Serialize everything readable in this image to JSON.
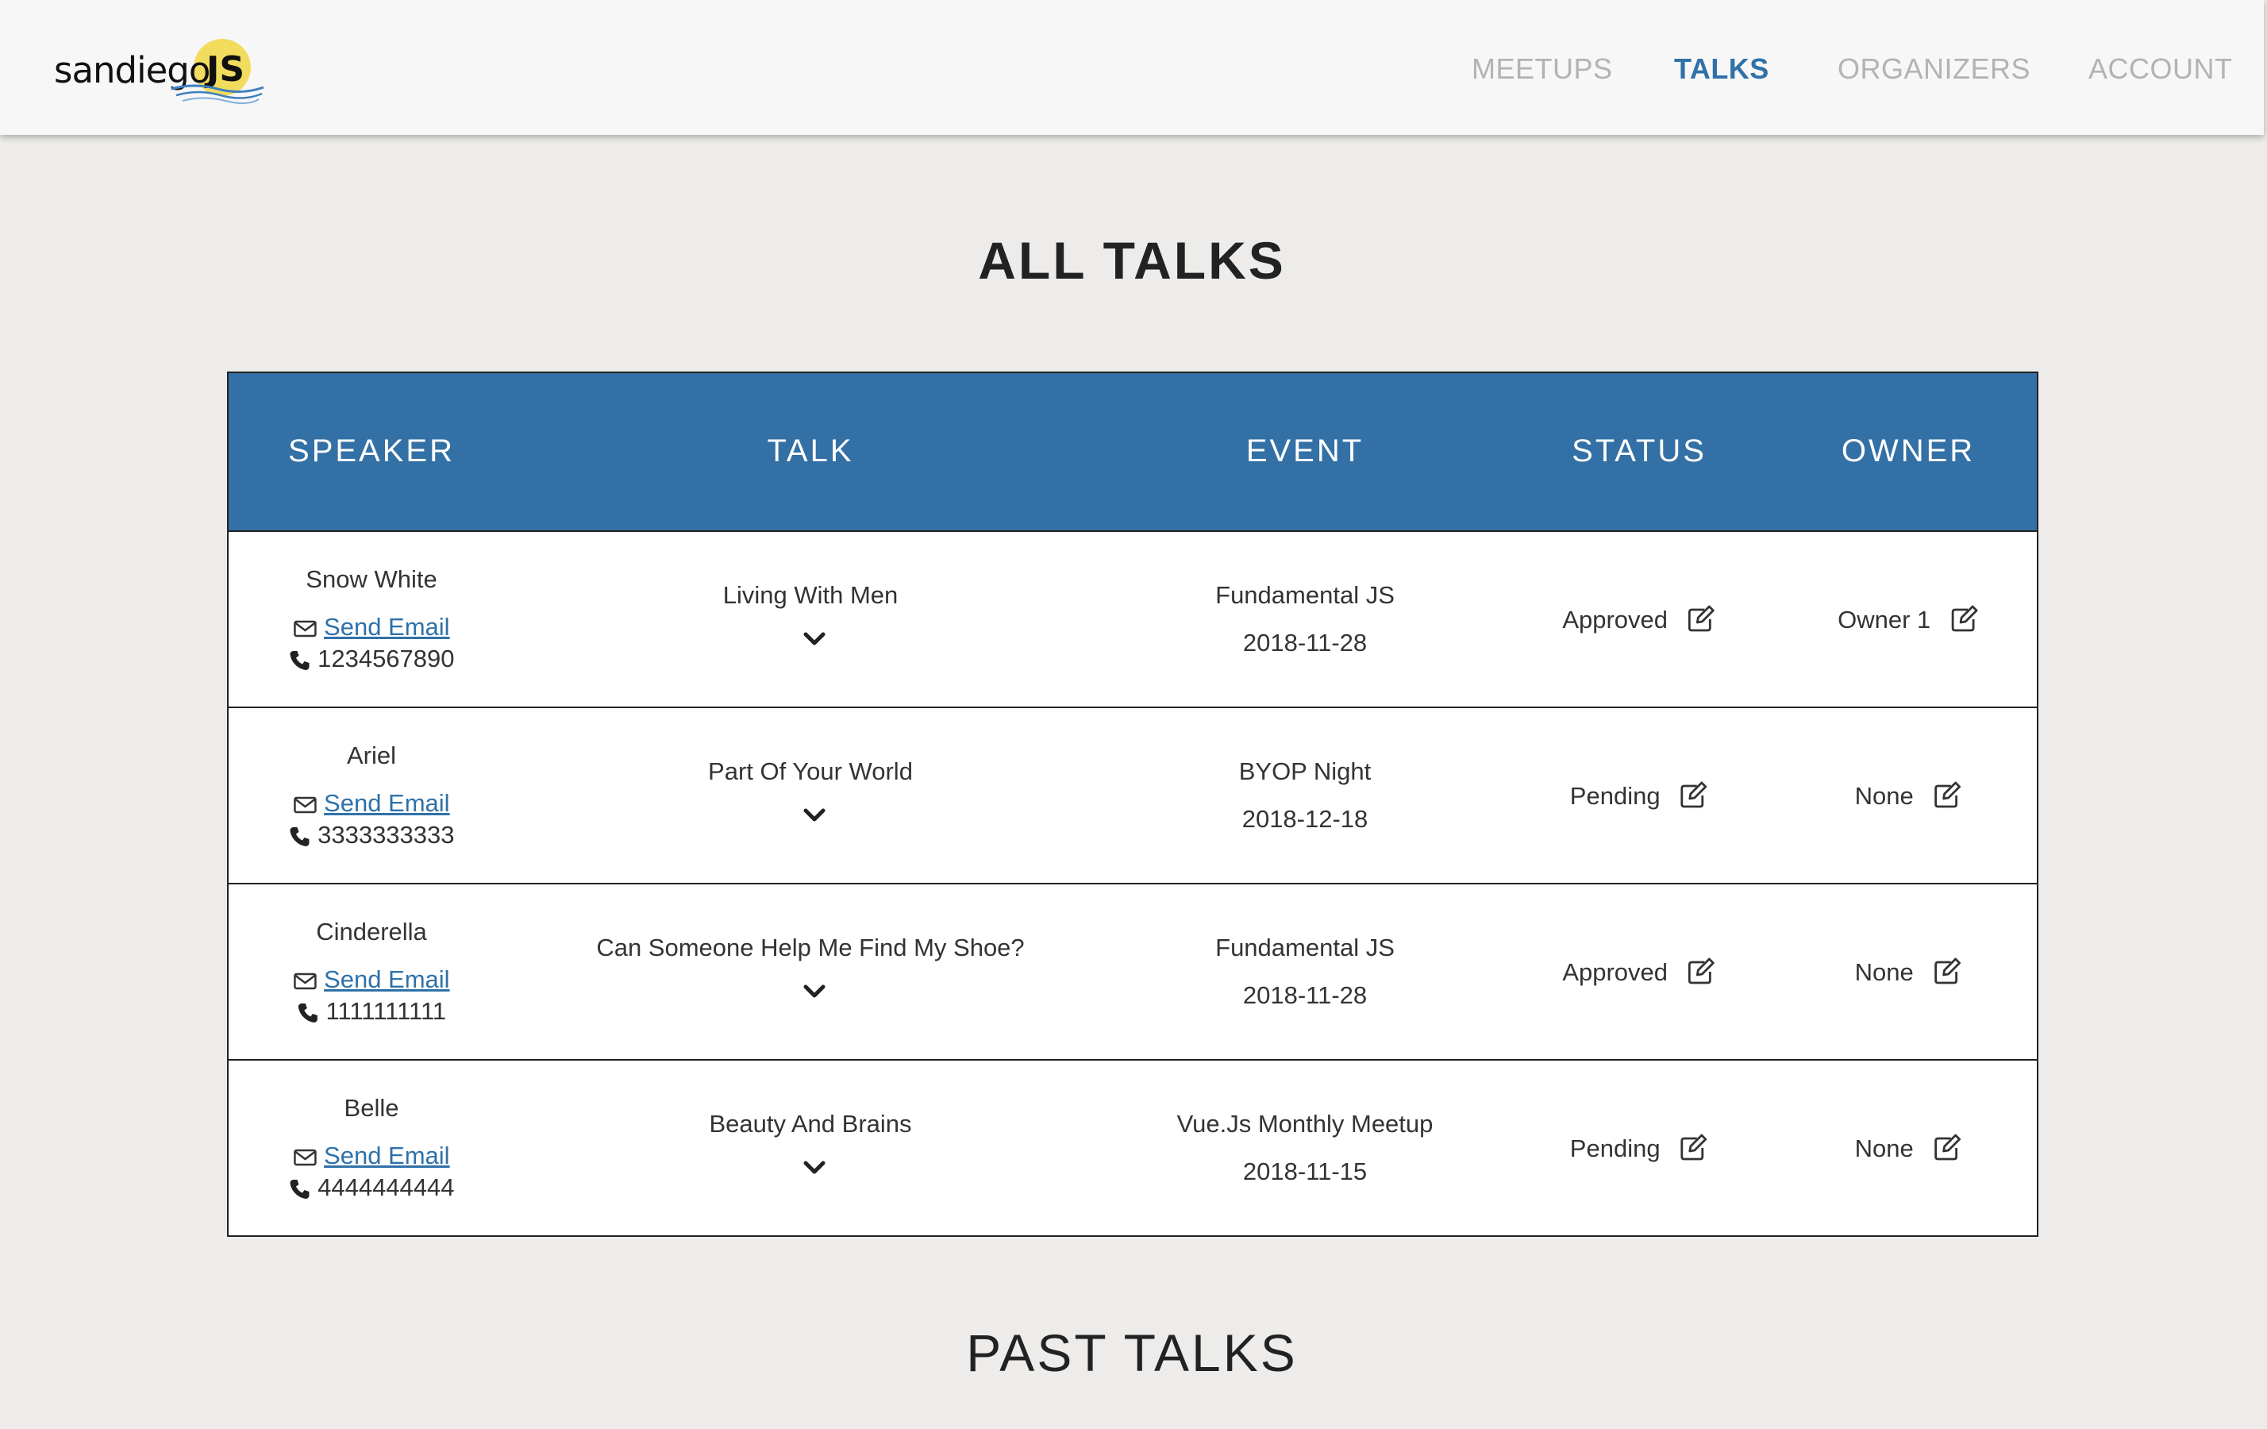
{
  "brand": {
    "word": "sandiego",
    "accent": "JS",
    "sun_color": "#f2dc5d",
    "wave_color": "#3f7fc1"
  },
  "nav": {
    "items": [
      {
        "label": "MEETUPS",
        "active": false
      },
      {
        "label": "TALKS",
        "active": true
      },
      {
        "label": "ORGANIZERS",
        "active": false
      },
      {
        "label": "ACCOUNT",
        "active": false
      }
    ],
    "active_color": "#2f71a8",
    "inactive_color": "#b3b3b3"
  },
  "page": {
    "title": "ALL TALKS",
    "past_title": "PAST TALKS"
  },
  "table": {
    "header_color": "#3370a5",
    "columns": [
      "SPEAKER",
      "TALK",
      "EVENT",
      "STATUS",
      "OWNER"
    ],
    "rows": [
      {
        "speaker": "Snow White",
        "email_label": "Send Email",
        "phone": "1234567890",
        "talk": "Living With Men",
        "event": "Fundamental JS",
        "date": "2018-11-28",
        "status": "Approved",
        "owner": "Owner 1"
      },
      {
        "speaker": "Ariel",
        "email_label": "Send Email",
        "phone": "3333333333",
        "talk": "Part Of Your World",
        "event": "BYOP Night",
        "date": "2018-12-18",
        "status": "Pending",
        "owner": "None"
      },
      {
        "speaker": "Cinderella",
        "email_label": "Send Email",
        "phone": "1111111111",
        "talk": "Can Someone Help Me Find My Shoe?",
        "event": "Fundamental JS",
        "date": "2018-11-28",
        "status": "Approved",
        "owner": "None"
      },
      {
        "speaker": "Belle",
        "email_label": "Send Email",
        "phone": "4444444444",
        "talk": "Beauty And Brains",
        "event": "Vue.Js Monthly Meetup",
        "date": "2018-11-15",
        "status": "Pending",
        "owner": "None"
      }
    ]
  },
  "icons": {
    "email": "envelope-icon",
    "phone": "phone-icon",
    "expand": "chevron-down-icon",
    "edit": "edit-icon"
  }
}
